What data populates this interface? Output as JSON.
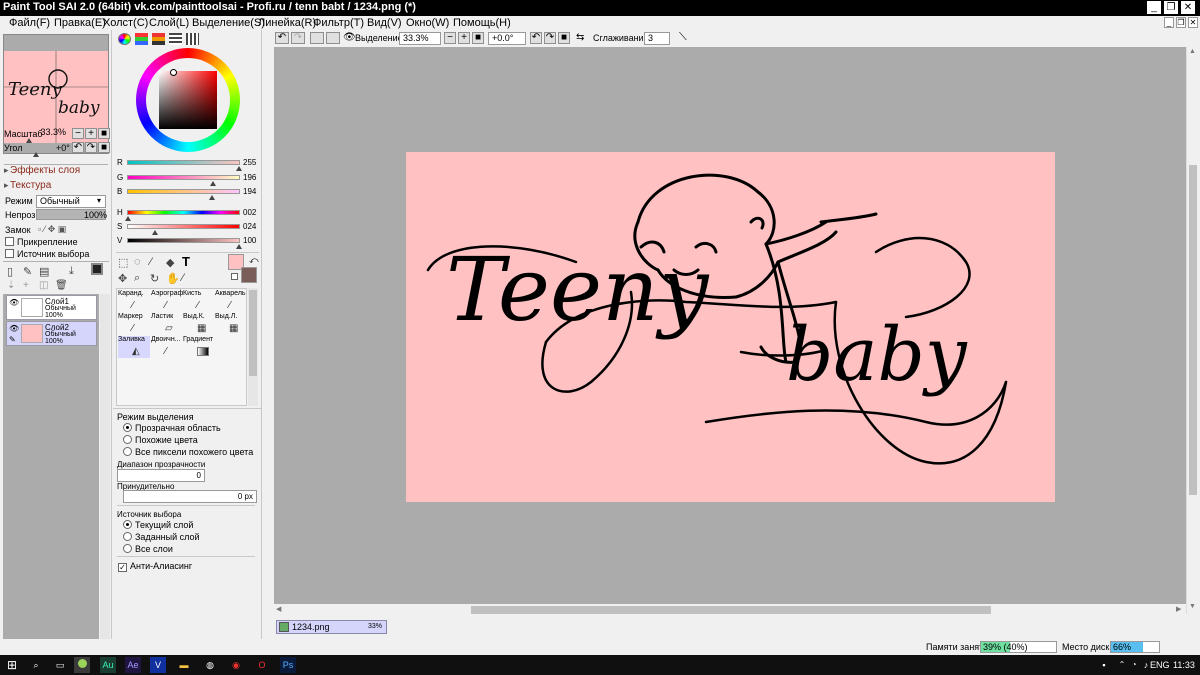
{
  "titlebar": {
    "title": "Paint Tool SAI 2.0 (64bit) vk.com/painttoolsai - Profi.ru / tenn babt / 1234.png (*)",
    "minimize": "_",
    "restore": "❐",
    "close": "✕"
  },
  "menu": [
    "Файл(F)",
    "Правка(E)",
    "Холст(C)",
    "Слой(L)",
    "Выделение(S)",
    "Линейка(R)",
    "Фильтр(T)",
    "Вид(V)",
    "Окно(W)",
    "Помощь(H)"
  ],
  "navigator": {
    "scale_label": "Масштаб",
    "scale_value": "33.3%",
    "angle_label": "Угол",
    "angle_value": "+0°",
    "thumb_text_1": "Teeny",
    "thumb_text_2": "baby"
  },
  "layer_panel": {
    "effects": "Эффекты слоя",
    "texture": "Текстура",
    "mode_label": "Режим",
    "mode_value": "Обычный",
    "opacity_label": "Непроз.",
    "opacity_value": "100%",
    "lock_label": "Замок",
    "clip_label": "Прикрепление",
    "source_label": "Источник выбора",
    "layers": [
      {
        "name": "Слой1",
        "mode": "Обычный",
        "opacity": "100%"
      },
      {
        "name": "Слой2",
        "mode": "Обычный",
        "opacity": "100%"
      }
    ]
  },
  "color": {
    "primary": "#ffc1c1",
    "secondary": "#7a5c58",
    "sliders": [
      {
        "label": "R",
        "value": "255"
      },
      {
        "label": "G",
        "value": "196"
      },
      {
        "label": "B",
        "value": "194"
      },
      {
        "label": "H",
        "value": "002"
      },
      {
        "label": "S",
        "value": "024"
      },
      {
        "label": "V",
        "value": "100"
      }
    ]
  },
  "tools": [
    {
      "label": "Каранд.",
      "icon": "pencil-icon"
    },
    {
      "label": "Аэрограф",
      "icon": "airbrush-icon"
    },
    {
      "label": "Кисть",
      "icon": "brush-icon"
    },
    {
      "label": "Акварель",
      "icon": "watercolor-icon"
    },
    {
      "label": "Маркер",
      "icon": "marker-icon"
    },
    {
      "label": "Ластик",
      "icon": "eraser-icon"
    },
    {
      "label": "Выд.К.",
      "icon": "select-pen-icon"
    },
    {
      "label": "Выд.Л.",
      "icon": "select-eraser-icon"
    },
    {
      "label": "Заливка",
      "icon": "bucket-icon"
    },
    {
      "label": "Двоичн...",
      "icon": "binary-pen-icon"
    },
    {
      "label": "Градиент",
      "icon": "gradient-icon"
    }
  ],
  "fill_options": {
    "selection_mode_title": "Режим выделения",
    "selection_modes": [
      "Прозрачная область",
      "Похожие цвета",
      "Все пиксели похожего цвета"
    ],
    "transparency_range_label": "Диапазон прозрачности",
    "transparency_range_value": "0",
    "force_label": "Принудительно",
    "force_value": "0 px",
    "source_title": "Источник выбора",
    "sources": [
      "Текущий слой",
      "Заданный слой",
      "Все слои"
    ],
    "antialias_label": "Анти-Алиасинг"
  },
  "toolbar": {
    "selection_label": "Выделение",
    "zoom": "33.3%",
    "angle": "+0.0°",
    "smoothing_label": "Сглаживание",
    "smoothing_value": "3"
  },
  "canvas": {
    "text_1": "Teeny",
    "text_2": "baby"
  },
  "file_tab": {
    "name": "1234.png",
    "zoom": "33%"
  },
  "status": {
    "memory_label": "Памяти занято",
    "memory_value": "39% (40%)",
    "memory_fraction": 0.39,
    "disk_label": "Место диска",
    "disk_value": "66%",
    "disk_fraction": 0.66
  },
  "taskbar": {
    "apps": [
      "Au",
      "Ae",
      "V",
      "Ps"
    ],
    "lang": "ENG",
    "time": "11:33"
  }
}
